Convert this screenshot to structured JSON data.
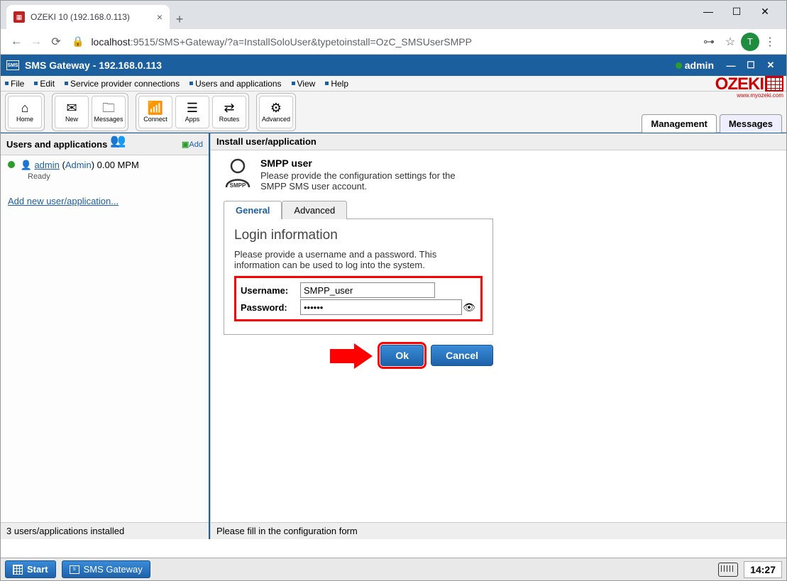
{
  "browser": {
    "tab_title": "OZEKI 10 (192.168.0.113)",
    "url_host": "localhost",
    "url_port_path": ":9515/SMS+Gateway/?a=InstallSoloUser&typetoinstall=OzC_SMSUserSMPP",
    "avatar_letter": "T"
  },
  "app_bar": {
    "title": "SMS Gateway - 192.168.0.113",
    "user": "admin"
  },
  "menu": {
    "file": "File",
    "edit": "Edit",
    "spc": "Service provider connections",
    "ua": "Users and applications",
    "view": "View",
    "help": "Help"
  },
  "logo": {
    "text": "OZEKI",
    "sub": "www.myozeki.com"
  },
  "toolbar": {
    "home": "Home",
    "new": "New",
    "messages": "Messages",
    "connect": "Connect",
    "apps": "Apps",
    "routes": "Routes",
    "advanced": "Advanced"
  },
  "side_tabs": {
    "management": "Management",
    "messages": "Messages"
  },
  "left_panel": {
    "title": "Users and applications",
    "add": "Add",
    "user_name": "admin",
    "user_role": "Admin",
    "user_rate": "0.00 MPM",
    "user_status": "Ready",
    "add_new": "Add new user/application...",
    "footer": "3 users/applications installed"
  },
  "right_panel": {
    "title": "Install user/application",
    "smpp_title": "SMPP user",
    "smpp_desc": "Please provide the configuration settings for the SMPP SMS user account.",
    "tab_general": "General",
    "tab_advanced": "Advanced",
    "box_title": "Login information",
    "box_desc": "Please provide a username and a password. This information can be used to log into the system.",
    "label_user": "Username:",
    "label_pass": "Password:",
    "val_user": "SMPP_user",
    "val_pass": "••••••",
    "btn_ok": "Ok",
    "btn_cancel": "Cancel",
    "footer": "Please fill in the configuration form"
  },
  "taskbar": {
    "start": "Start",
    "app": "SMS Gateway",
    "time": "14:27"
  }
}
